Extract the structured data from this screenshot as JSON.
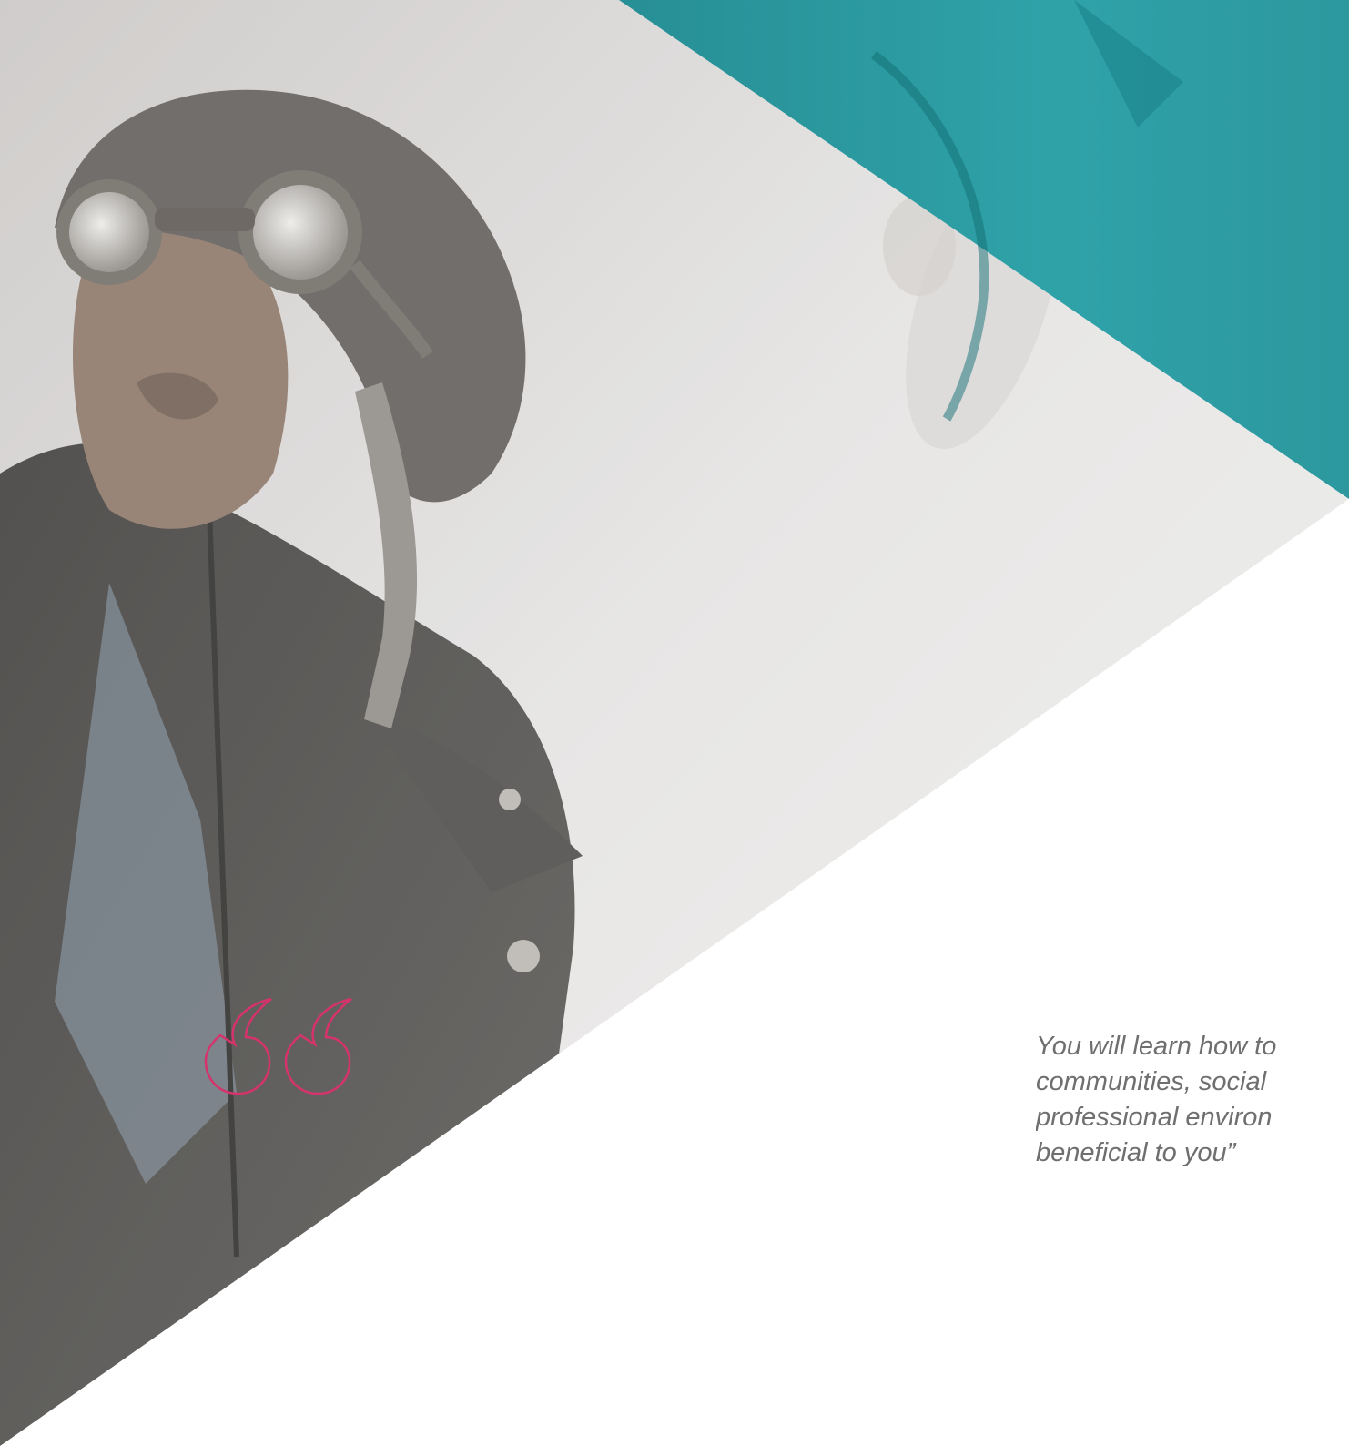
{
  "colors": {
    "accent_teal": "#1f9aa2",
    "quote_mark": "#d6336c",
    "quote_text": "#6f6f6f",
    "background": "#ffffff"
  },
  "hero": {
    "image_subject": "aviator-with-goggles-illustration",
    "decorative_icon": "quote-open-icon"
  },
  "testimonial": {
    "lines": [
      "You will learn how to",
      "communities, social",
      "professional environ",
      "beneficial to you”"
    ]
  }
}
